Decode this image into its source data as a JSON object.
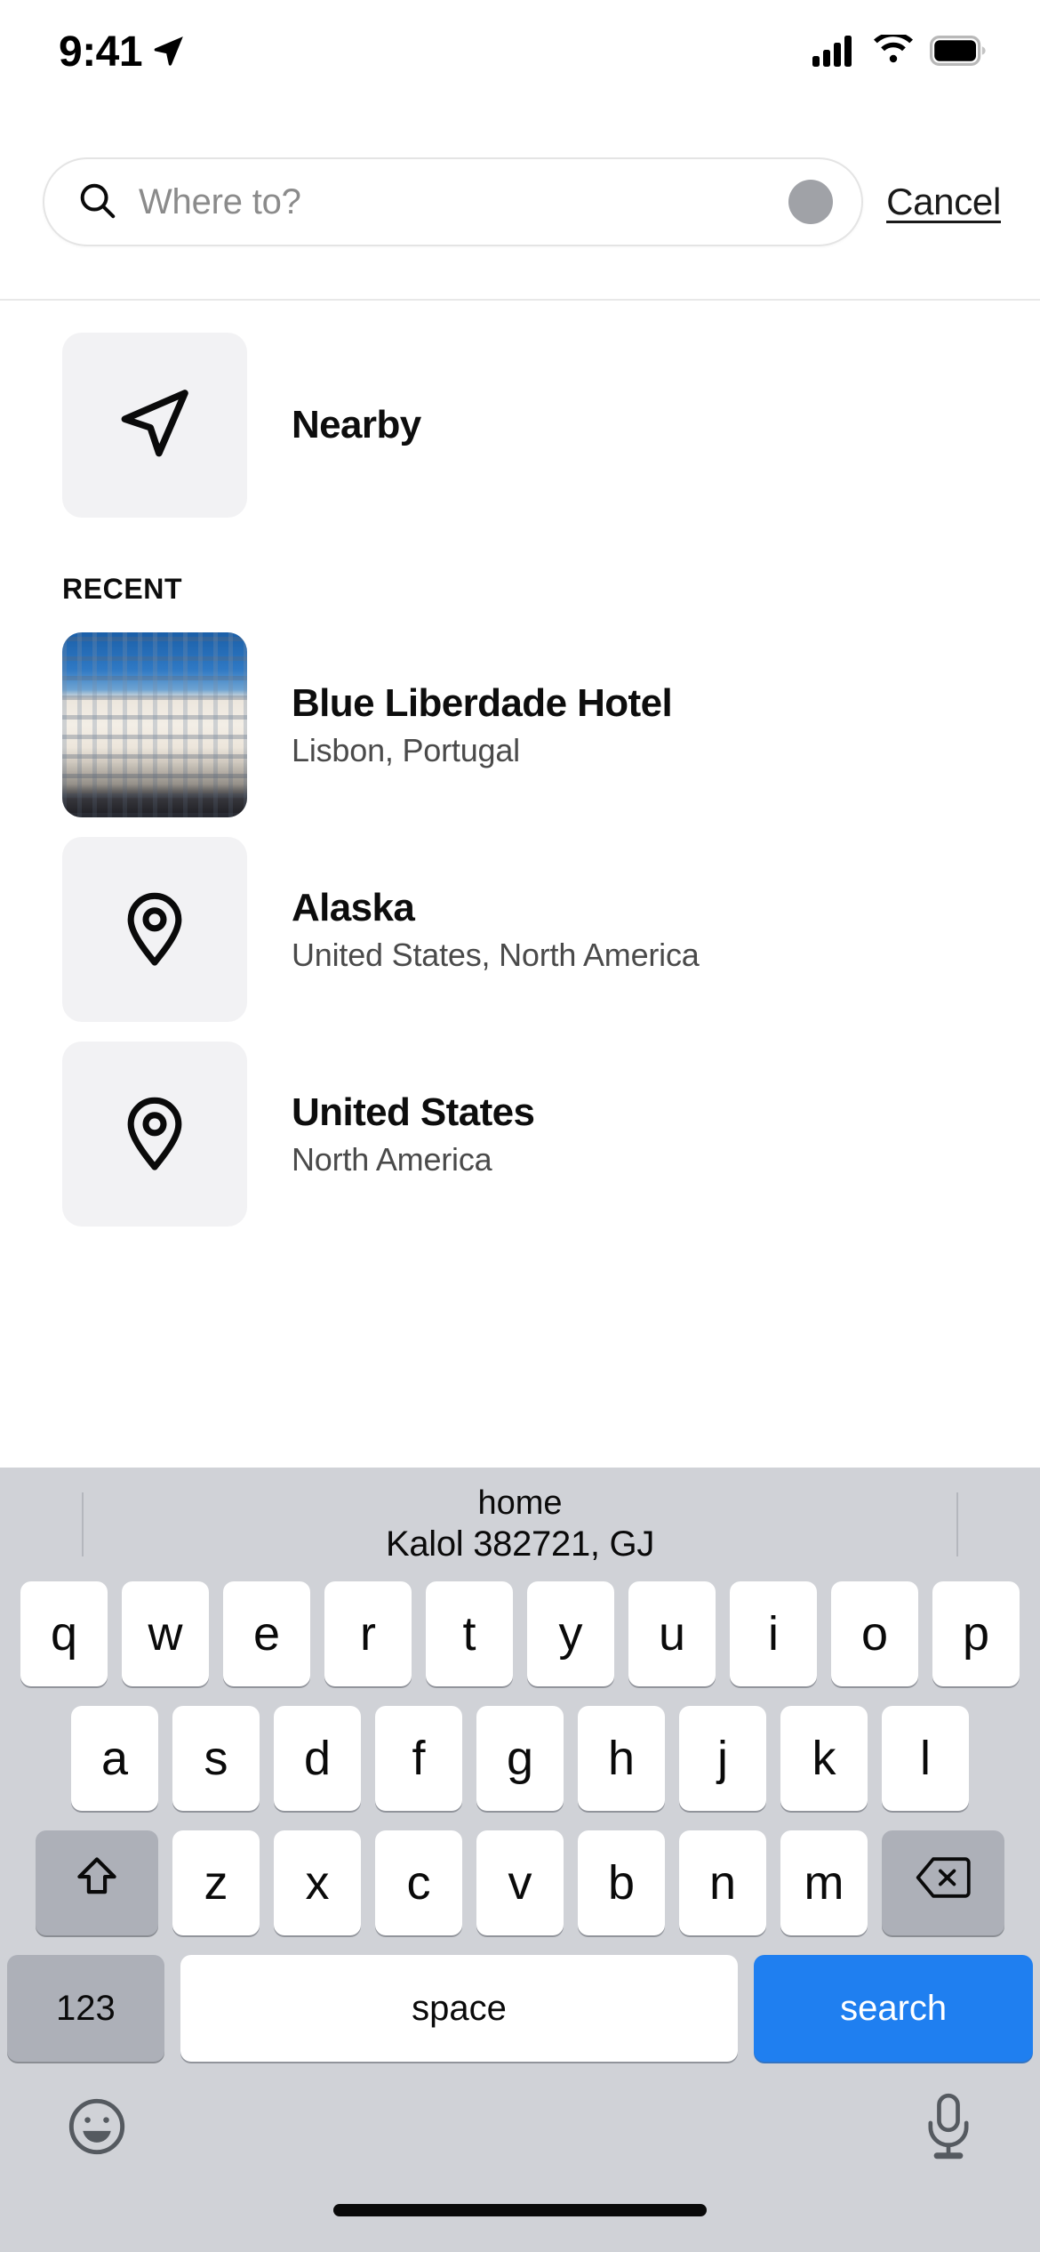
{
  "status_bar": {
    "time": "9:41",
    "location_arrow_icon": "location-arrow-icon",
    "cellular_icon": "cellular-bars-icon",
    "wifi_icon": "wifi-icon",
    "battery_icon": "battery-full-icon"
  },
  "search": {
    "placeholder": "Where to?",
    "value": "",
    "search_icon": "search-icon",
    "clear_icon": "clear-circle-icon",
    "cancel_label": "Cancel"
  },
  "nearby": {
    "title": "Nearby",
    "icon": "navigation-arrow-icon"
  },
  "recent": {
    "section_label": "RECENT",
    "items": [
      {
        "title": "Blue Liberdade Hotel",
        "subtitle": "Lisbon, Portugal",
        "icon": "hotel-photo-thumbnail"
      },
      {
        "title": "Alaska",
        "subtitle": "United States, North America",
        "icon": "map-pin-icon"
      },
      {
        "title": "United States",
        "subtitle": "North America",
        "icon": "map-pin-icon"
      }
    ]
  },
  "keyboard": {
    "predictions": {
      "line1": "home",
      "line2": "Kalol 382721, GJ"
    },
    "row1": [
      "q",
      "w",
      "e",
      "r",
      "t",
      "y",
      "u",
      "i",
      "o",
      "p"
    ],
    "row2": [
      "a",
      "s",
      "d",
      "f",
      "g",
      "h",
      "j",
      "k",
      "l"
    ],
    "row3": [
      "z",
      "x",
      "c",
      "v",
      "b",
      "n",
      "m"
    ],
    "shift_icon": "shift-arrow-icon",
    "backspace_icon": "backspace-icon",
    "numbers_label": "123",
    "space_label": "space",
    "return_label": "search",
    "emoji_icon": "emoji-smiley-icon",
    "mic_icon": "microphone-icon"
  },
  "colors": {
    "accent_blue": "#1f7ff0",
    "keyboard_bg": "#d0d2d7",
    "key_white": "#ffffff",
    "key_gray": "#adb0b8",
    "thumb_bg": "#f2f2f4",
    "subtitle_gray": "#4a4a4a",
    "placeholder_gray": "#8b8b8b"
  }
}
